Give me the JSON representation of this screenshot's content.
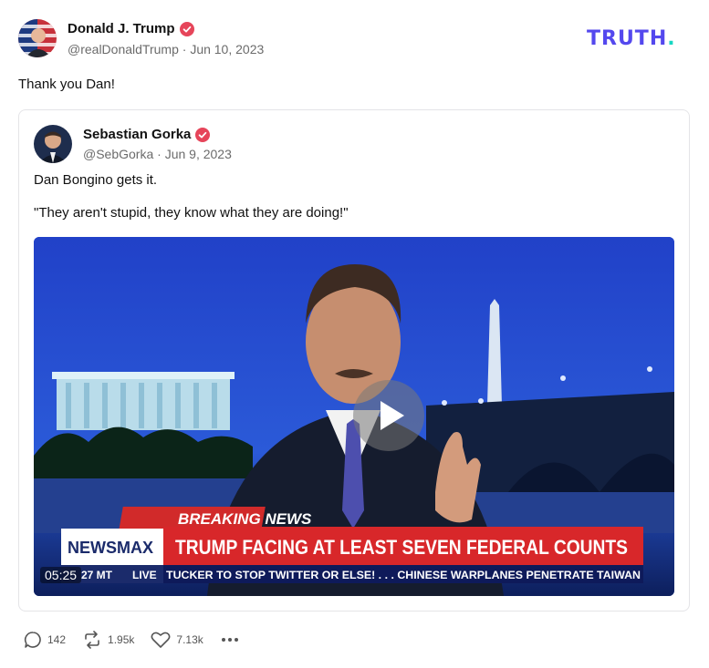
{
  "brand": {
    "logo_main": "TRUTH",
    "logo_dot": ".",
    "accent": "#5448ee",
    "dot_color": "#17d7c3",
    "verified_color": "#e6455a"
  },
  "post": {
    "author": {
      "name": "Donald J. Trump",
      "handle": "@realDonaldTrump",
      "date": "Jun 10, 2023",
      "verified_icon": "verified-badge-icon"
    },
    "text": "Thank you Dan!",
    "quote": {
      "author": {
        "name": "Sebastian Gorka",
        "handle": "@SebGorka",
        "date": "Jun 9, 2023",
        "verified_icon": "verified-badge-icon"
      },
      "text_line1": "Dan Bongino gets it.",
      "text_line2": "\"They aren't stupid, they know what they are doing!\"",
      "video": {
        "duration": "05:25",
        "banner_top": "BREAKING NEWS",
        "network": "NEWSMAX",
        "headline": "TRUMP FACING AT LEAST SEVEN FEDERAL COUNTS",
        "clock": "27 MT",
        "live": "LIVE",
        "ticker": "TUCKER TO STOP TWITTER OR ELSE! . . .     CHINESE WARPLANES PENETRATE TAIWAN"
      }
    },
    "actions": {
      "replies": "142",
      "retruths": "1.95k",
      "likes": "7.13k"
    }
  },
  "post_meta": {
    "separator": " · "
  }
}
